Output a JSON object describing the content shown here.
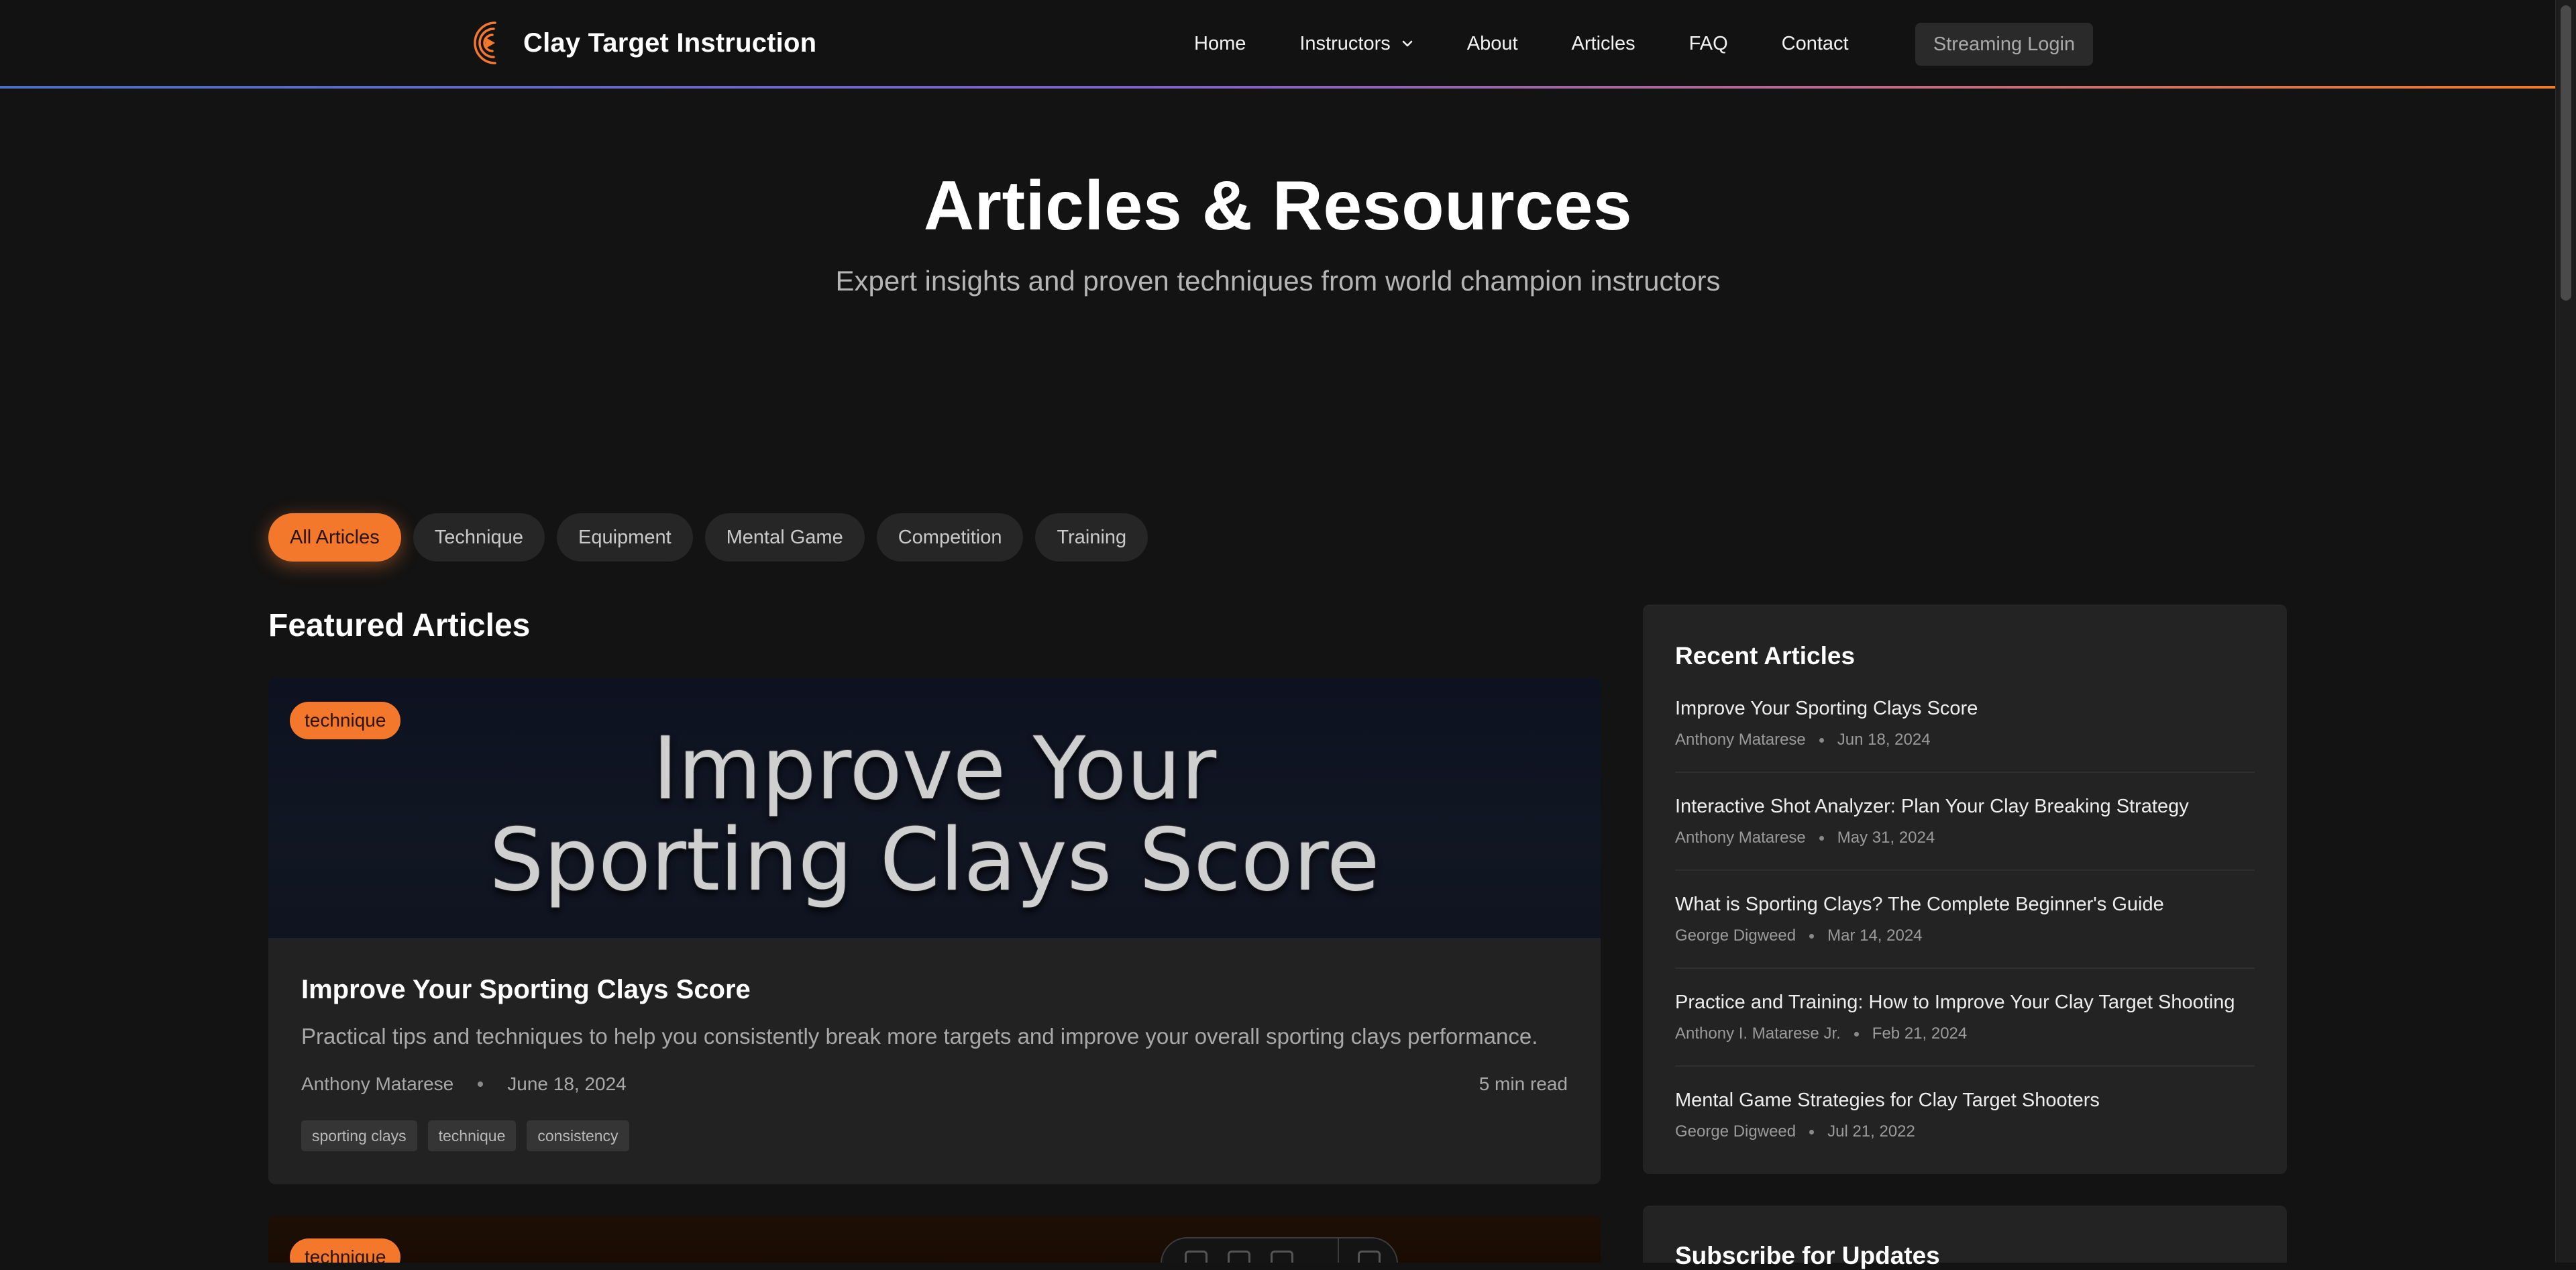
{
  "brand": {
    "name": "Clay Target Instruction",
    "logo_icon": "play-target-logo-icon",
    "accent": "#f4782c"
  },
  "nav": {
    "links": [
      "Home",
      "Instructors",
      "About",
      "Articles",
      "FAQ",
      "Contact"
    ],
    "streaming_login": "Streaming Login"
  },
  "hero": {
    "title": "Articles & Resources",
    "subtitle": "Expert insights and proven techniques from world champion instructors"
  },
  "filters": [
    "All Articles",
    "Technique",
    "Equipment",
    "Mental Game",
    "Competition",
    "Training"
  ],
  "featured": {
    "section_title": "Featured Articles",
    "cards": [
      {
        "badge": "technique",
        "image_text_line1": "Improve Your",
        "image_text_line2": "Sporting Clays Score",
        "title": "Improve Your Sporting Clays Score",
        "excerpt": "Practical tips and techniques to help you consistently break more targets and improve your overall sporting clays performance.",
        "author": "Anthony Matarese",
        "date": "June 18, 2024",
        "read_time": "5 min read",
        "tags": [
          "sporting clays",
          "technique",
          "consistency"
        ]
      },
      {
        "badge": "technique"
      }
    ]
  },
  "sidebar": {
    "title": "Recent Articles",
    "items": [
      {
        "title": "Improve Your Sporting Clays Score",
        "author": "Anthony Matarese",
        "date": "Jun 18, 2024"
      },
      {
        "title": "Interactive Shot Analyzer: Plan Your Clay Breaking Strategy",
        "author": "Anthony Matarese",
        "date": "May 31, 2024"
      },
      {
        "title": "What is Sporting Clays? The Complete Beginner's Guide",
        "author": "George Digweed",
        "date": "Mar 14, 2024"
      },
      {
        "title": "Practice and Training: How to Improve Your Clay Target Shooting",
        "author": "Anthony I. Matarese Jr.",
        "date": "Feb 21, 2024"
      },
      {
        "title": "Mental Game Strategies for Clay Target Shooters",
        "author": "George Digweed",
        "date": "Jul 21, 2022"
      }
    ],
    "subscribe_title": "Subscribe for Updates"
  }
}
